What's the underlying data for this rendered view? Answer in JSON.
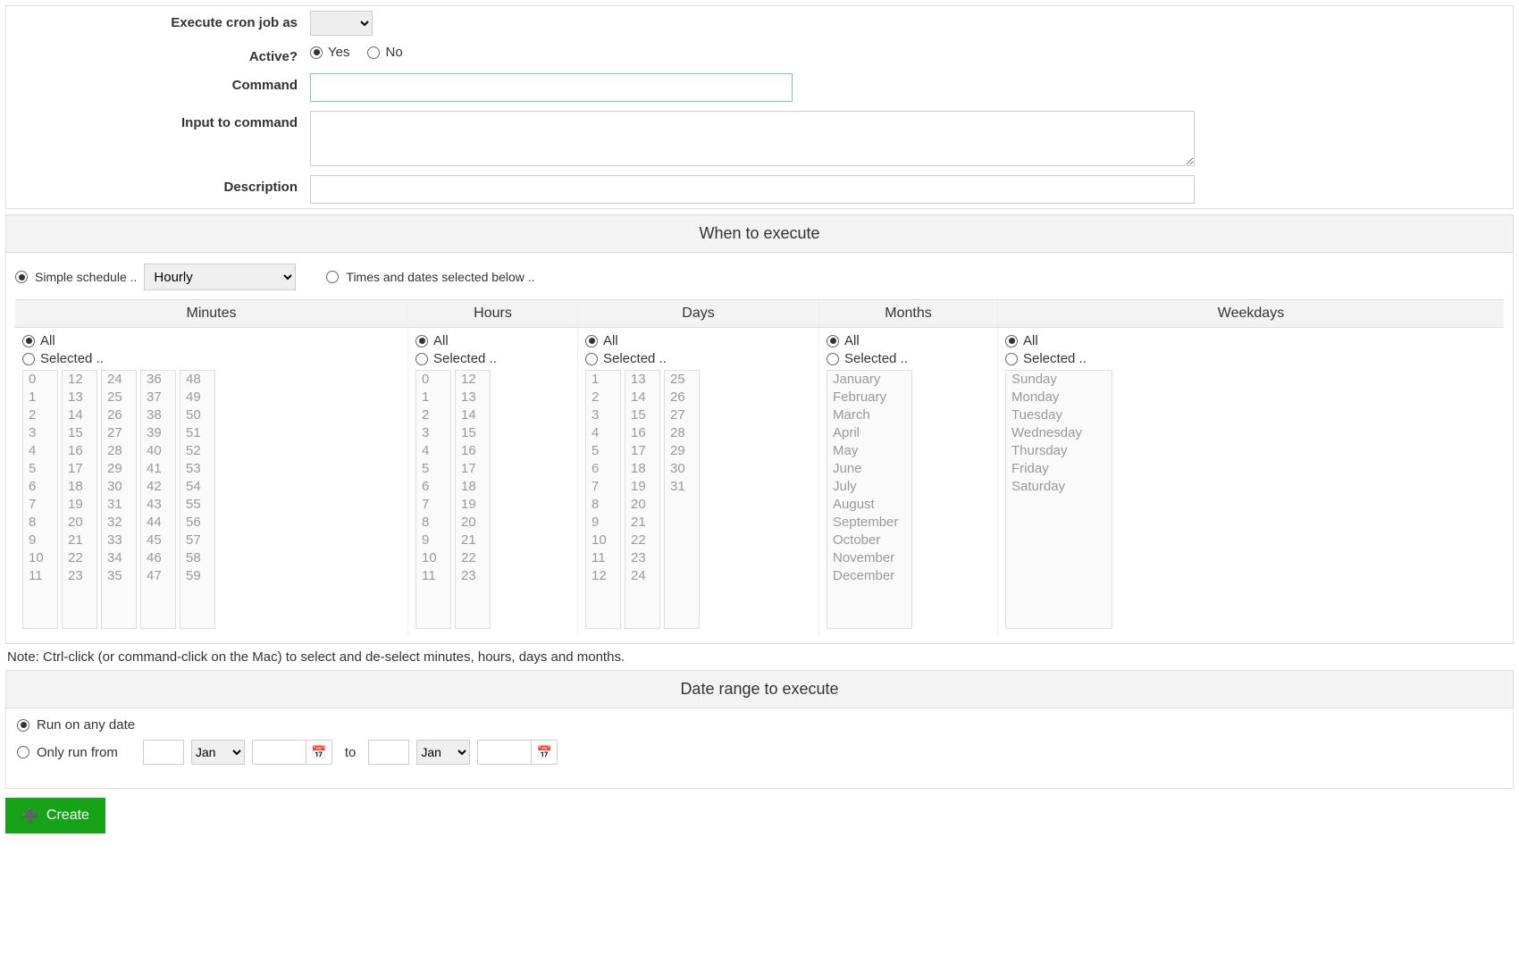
{
  "labels": {
    "exec_as": "Execute cron job as",
    "active": "Active?",
    "yes": "Yes",
    "no": "No",
    "command": "Command",
    "input_cmd": "Input to command",
    "description": "Description"
  },
  "exec_as_value": "",
  "command_value": "",
  "input_value": "",
  "description_value": "",
  "active_selected": "yes",
  "section_when": "When to execute",
  "schedule": {
    "simple_label": "Simple schedule ..",
    "simple_checked": true,
    "freq_value": "Hourly",
    "custom_label": "Times and dates selected below ..",
    "custom_checked": false
  },
  "columns": {
    "minutes": {
      "title": "Minutes",
      "all": "All",
      "selected": "Selected ..",
      "mode": "all",
      "lists": [
        [
          "0",
          "1",
          "2",
          "3",
          "4",
          "5",
          "6",
          "7",
          "8",
          "9",
          "10",
          "11"
        ],
        [
          "12",
          "13",
          "14",
          "15",
          "16",
          "17",
          "18",
          "19",
          "20",
          "21",
          "22",
          "23"
        ],
        [
          "24",
          "25",
          "26",
          "27",
          "28",
          "29",
          "30",
          "31",
          "32",
          "33",
          "34",
          "35"
        ],
        [
          "36",
          "37",
          "38",
          "39",
          "40",
          "41",
          "42",
          "43",
          "44",
          "45",
          "46",
          "47"
        ],
        [
          "48",
          "49",
          "50",
          "51",
          "52",
          "53",
          "54",
          "55",
          "56",
          "57",
          "58",
          "59"
        ]
      ]
    },
    "hours": {
      "title": "Hours",
      "all": "All",
      "selected": "Selected ..",
      "mode": "all",
      "lists": [
        [
          "0",
          "1",
          "2",
          "3",
          "4",
          "5",
          "6",
          "7",
          "8",
          "9",
          "10",
          "11"
        ],
        [
          "12",
          "13",
          "14",
          "15",
          "16",
          "17",
          "18",
          "19",
          "20",
          "21",
          "22",
          "23"
        ]
      ]
    },
    "days": {
      "title": "Days",
      "all": "All",
      "selected": "Selected ..",
      "mode": "all",
      "lists": [
        [
          "1",
          "2",
          "3",
          "4",
          "5",
          "6",
          "7",
          "8",
          "9",
          "10",
          "11",
          "12"
        ],
        [
          "13",
          "14",
          "15",
          "16",
          "17",
          "18",
          "19",
          "20",
          "21",
          "22",
          "23",
          "24"
        ],
        [
          "25",
          "26",
          "27",
          "28",
          "29",
          "30",
          "31"
        ]
      ]
    },
    "months": {
      "title": "Months",
      "all": "All",
      "selected": "Selected ..",
      "mode": "all",
      "lists": [
        [
          "January",
          "February",
          "March",
          "April",
          "May",
          "June",
          "July",
          "August",
          "September",
          "October",
          "November",
          "December"
        ]
      ]
    },
    "weekdays": {
      "title": "Weekdays",
      "all": "All",
      "selected": "Selected ..",
      "mode": "all",
      "lists": [
        [
          "Sunday",
          "Monday",
          "Tuesday",
          "Wednesday",
          "Thursday",
          "Friday",
          "Saturday"
        ]
      ]
    }
  },
  "note": "Note: Ctrl-click (or command-click on the Mac) to select and de-select minutes, hours, days and months.",
  "section_range": "Date range to execute",
  "range": {
    "any_label": "Run on any date",
    "any_checked": true,
    "only_label": "Only run from",
    "only_checked": false,
    "from_month": "Jan",
    "to_label": "to",
    "to_month": "Jan"
  },
  "create_btn": "Create"
}
